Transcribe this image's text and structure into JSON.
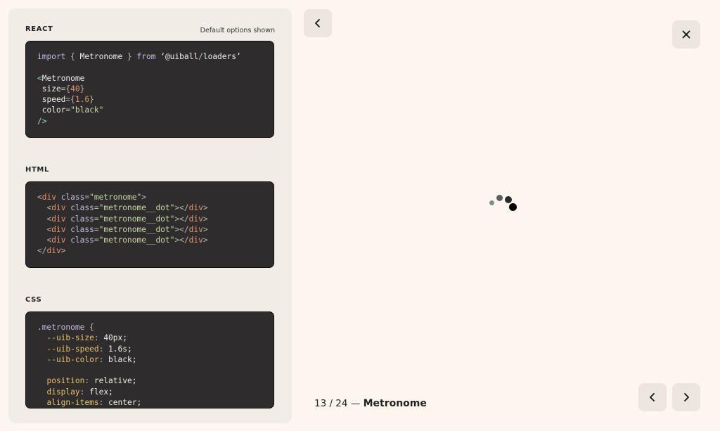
{
  "react": {
    "title": "REACT",
    "note": "Default options shown",
    "code": {
      "l1": {
        "import": "import",
        "brace": " { ",
        "name": "Metronome",
        "close": " } ",
        "from": "from",
        "sp": " ",
        "q1": "‘",
        "pkg": "@uiball",
        "slash": "/",
        "mod": "loaders",
        "q2": "’"
      },
      "l3": {
        "lt": "<",
        "name": "Metronome"
      },
      "size": {
        "attr": " size",
        "eq": "={",
        "val": "40",
        "end": "}"
      },
      "speed": {
        "attr": " speed",
        "eq": "={",
        "val": "1.6",
        "end": "}"
      },
      "color": {
        "attr": " color",
        "eq": "=",
        "val": "\"black\""
      },
      "close": "/>"
    }
  },
  "html": {
    "title": "HTML",
    "div_open": "<",
    "div": "div",
    "class_kw": " class",
    "eq": "=",
    "outer_class": "\"metronome\"",
    "gt": ">",
    "dot_class": "\"metronome__dot\"",
    "close_open": "></",
    "close_tag": "</",
    "indent": "  "
  },
  "css": {
    "title": "CSS",
    "selector": ".metronome",
    "brace": " {",
    "rules": [
      {
        "prop": "  --uib-size",
        "value": "40px;"
      },
      {
        "prop": "  --uib-speed",
        "value": "1.6s;"
      },
      {
        "prop": "  --uib-color",
        "value": "black;"
      },
      {
        "prop": "",
        "value": ""
      },
      {
        "prop": "  position",
        "value": "relative;"
      },
      {
        "prop": "  display",
        "value": "flex;"
      },
      {
        "prop": "  align-items",
        "value": "center;"
      }
    ],
    "colon": ": "
  },
  "caption": {
    "counter": "13 / 24 — ",
    "name": "Metronome"
  },
  "icons": {
    "back": "chevron-left-icon",
    "close": "close-icon",
    "prev": "chevron-left-icon",
    "next": "chevron-right-icon"
  },
  "colors": {
    "background": "#fdf6ee",
    "panel": "#f1ece5",
    "code_bg": "#2f2c2d",
    "button": "#ece6de"
  }
}
